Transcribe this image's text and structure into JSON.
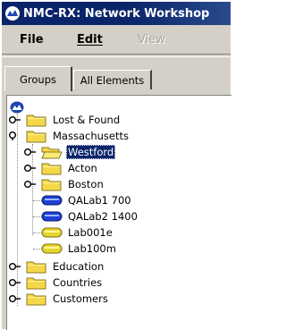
{
  "window": {
    "title": "NMC-RX: Network Workshop"
  },
  "menubar": {
    "file": "File",
    "edit": "Edit",
    "view": "View"
  },
  "tabs": {
    "groups": "Groups",
    "all_elements": "All Elements",
    "active": "Groups"
  },
  "tree": {
    "items": [
      {
        "label": "Lost & Found",
        "icon": "folder-icon",
        "expanded": false
      },
      {
        "label": "Massachusetts",
        "icon": "folder-icon",
        "expanded": true
      },
      {
        "label": "Westford",
        "icon": "open-folder-icon",
        "expanded": false,
        "selected": true
      },
      {
        "label": "Acton",
        "icon": "folder-icon",
        "expanded": false
      },
      {
        "label": "Boston",
        "icon": "folder-icon",
        "expanded": false
      },
      {
        "label": "QALab1 700",
        "icon": "router-icon-blue"
      },
      {
        "label": "QALab2 1400",
        "icon": "router-icon-blue"
      },
      {
        "label": "Lab001e",
        "icon": "device-icon-yellow"
      },
      {
        "label": "Lab100m",
        "icon": "device-icon-yellow"
      },
      {
        "label": "Education",
        "icon": "folder-icon",
        "expanded": false
      },
      {
        "label": "Countries",
        "icon": "folder-icon",
        "expanded": false
      },
      {
        "label": "Customers",
        "icon": "folder-icon",
        "expanded": false
      }
    ]
  },
  "colors": {
    "titlebar": "#0a246a",
    "selection": "#0a246a",
    "folder": "#f5d84a",
    "router": "#1f3fd6",
    "device": "#e6d430"
  }
}
